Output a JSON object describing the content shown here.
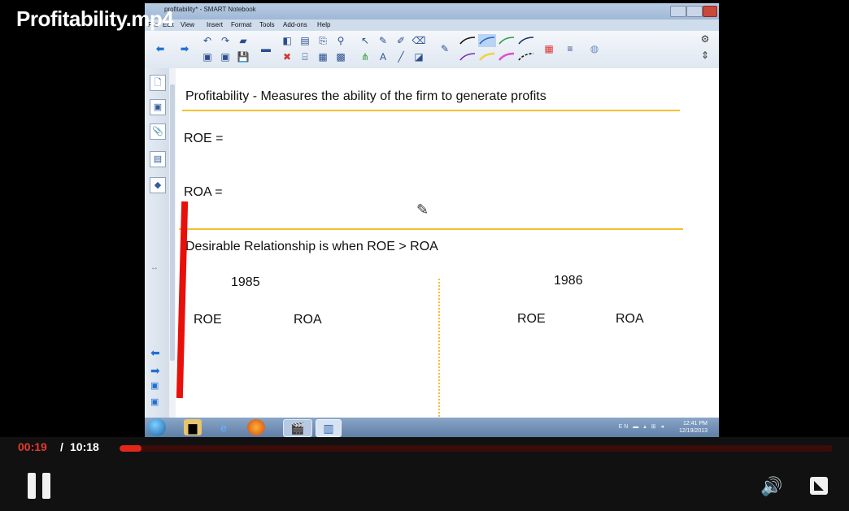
{
  "video": {
    "title": "Profitability.mp4",
    "time_current": "00:19",
    "time_separator": "/",
    "time_total": "10:18",
    "progress": 0.031
  },
  "window": {
    "title": "profitability* - SMART Notebook",
    "menu": [
      "File",
      "Edit",
      "View",
      "Insert",
      "Format",
      "Tools",
      "Add-ons",
      "Help"
    ]
  },
  "slide": {
    "heading": "Profitability - Measures the ability of the firm to generate profits",
    "roe_formula": "ROE =",
    "roa_formula": "ROA =",
    "relationship": "Desirable Relationship is when  ROE > ROA",
    "year_left": "1985",
    "year_right": "1986",
    "roe_left": "ROE",
    "roa_left": "ROA",
    "roe_right": "ROE",
    "roa_right": "ROA"
  },
  "taskbar": {
    "clock_time": "12:41 PM",
    "clock_date": "12/19/2013"
  },
  "colors": {
    "accent_red": "#e0271a",
    "highlight_yellow": "#f2c12e"
  },
  "icons": [
    "pause-icon",
    "volume-icon",
    "fullscreen-icon",
    "pen-icon"
  ]
}
